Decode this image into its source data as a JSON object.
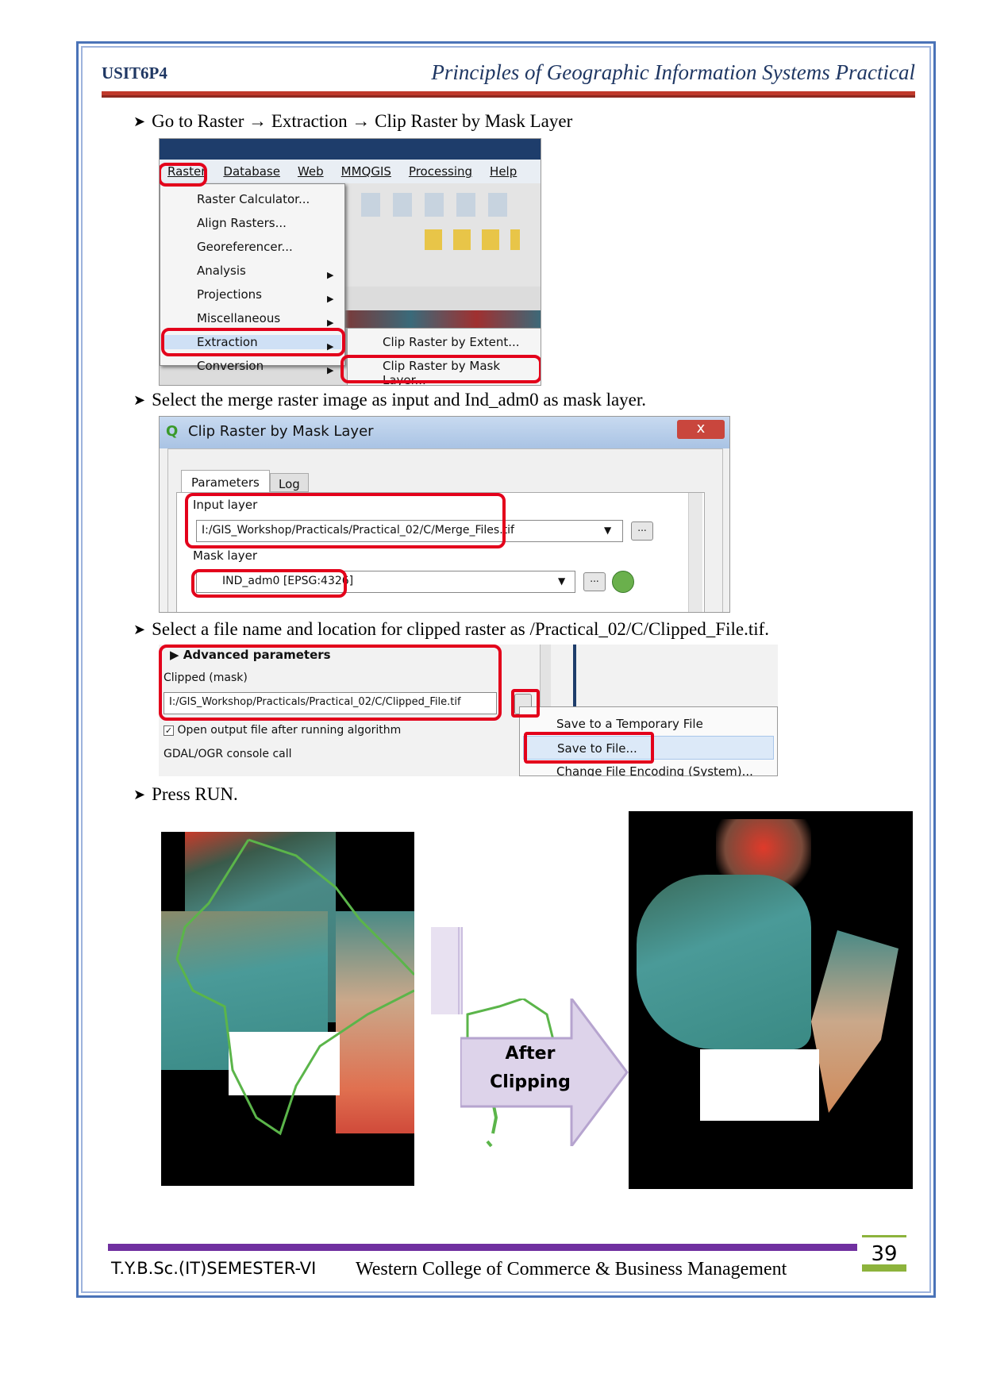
{
  "header": {
    "code": "USIT6P4",
    "title": "Principles of Geographic Information Systems Practical"
  },
  "steps": [
    "Go to Raster → Extraction → Clip Raster by Mask Layer",
    "Select the merge raster image as input and Ind_adm0 as mask layer.",
    "Select a file name and location for clipped raster as /Practical_02/C/Clipped_File.tif.",
    "Press RUN."
  ],
  "menubar": [
    "Raster",
    "Database",
    "Web",
    "MMQGIS",
    "Processing",
    "Help"
  ],
  "raster_menu": [
    "Raster Calculator...",
    "Align Rasters...",
    "Georeferencer...",
    "Analysis",
    "Projections",
    "Miscellaneous",
    "Extraction",
    "Conversion"
  ],
  "extraction_sub": [
    "Clip Raster by Extent...",
    "Clip Raster by Mask Layer..."
  ],
  "dialog": {
    "title": "Clip Raster by Mask Layer",
    "close": "x",
    "tabs": [
      "Parameters",
      "Log"
    ],
    "input_label": "Input layer",
    "input_value": "I:/GIS_Workshop/Practicals/Practical_02/C/Merge_Files.tif",
    "mask_label": "Mask layer",
    "mask_value": "IND_adm0 [EPSG:4326]",
    "browse": "..."
  },
  "output_panel": {
    "advanced": "Advanced parameters",
    "clipped_label": "Clipped (mask)",
    "clipped_value": "I:/GIS_Workshop/Practicals/Practical_02/C/Clipped_File.tif",
    "open_output": "Open output file after running algorithm",
    "gdal": "GDAL/OGR console call",
    "menu": [
      "Save to a Temporary File",
      "Save to File...",
      "Change File Encoding (System)..."
    ]
  },
  "result_arrow": "After Clipping",
  "footer": {
    "left": "T.Y.B.Sc.(IT)SEMESTER-VI",
    "center": "Western College of Commerce & Business Management",
    "page": "39"
  },
  "colors": {
    "accent_blue": "#4a73b8",
    "header_red": "#c0392b",
    "footer_purple": "#7030a0",
    "page_green": "#8db33c",
    "highlight_red": "#e3001b"
  }
}
